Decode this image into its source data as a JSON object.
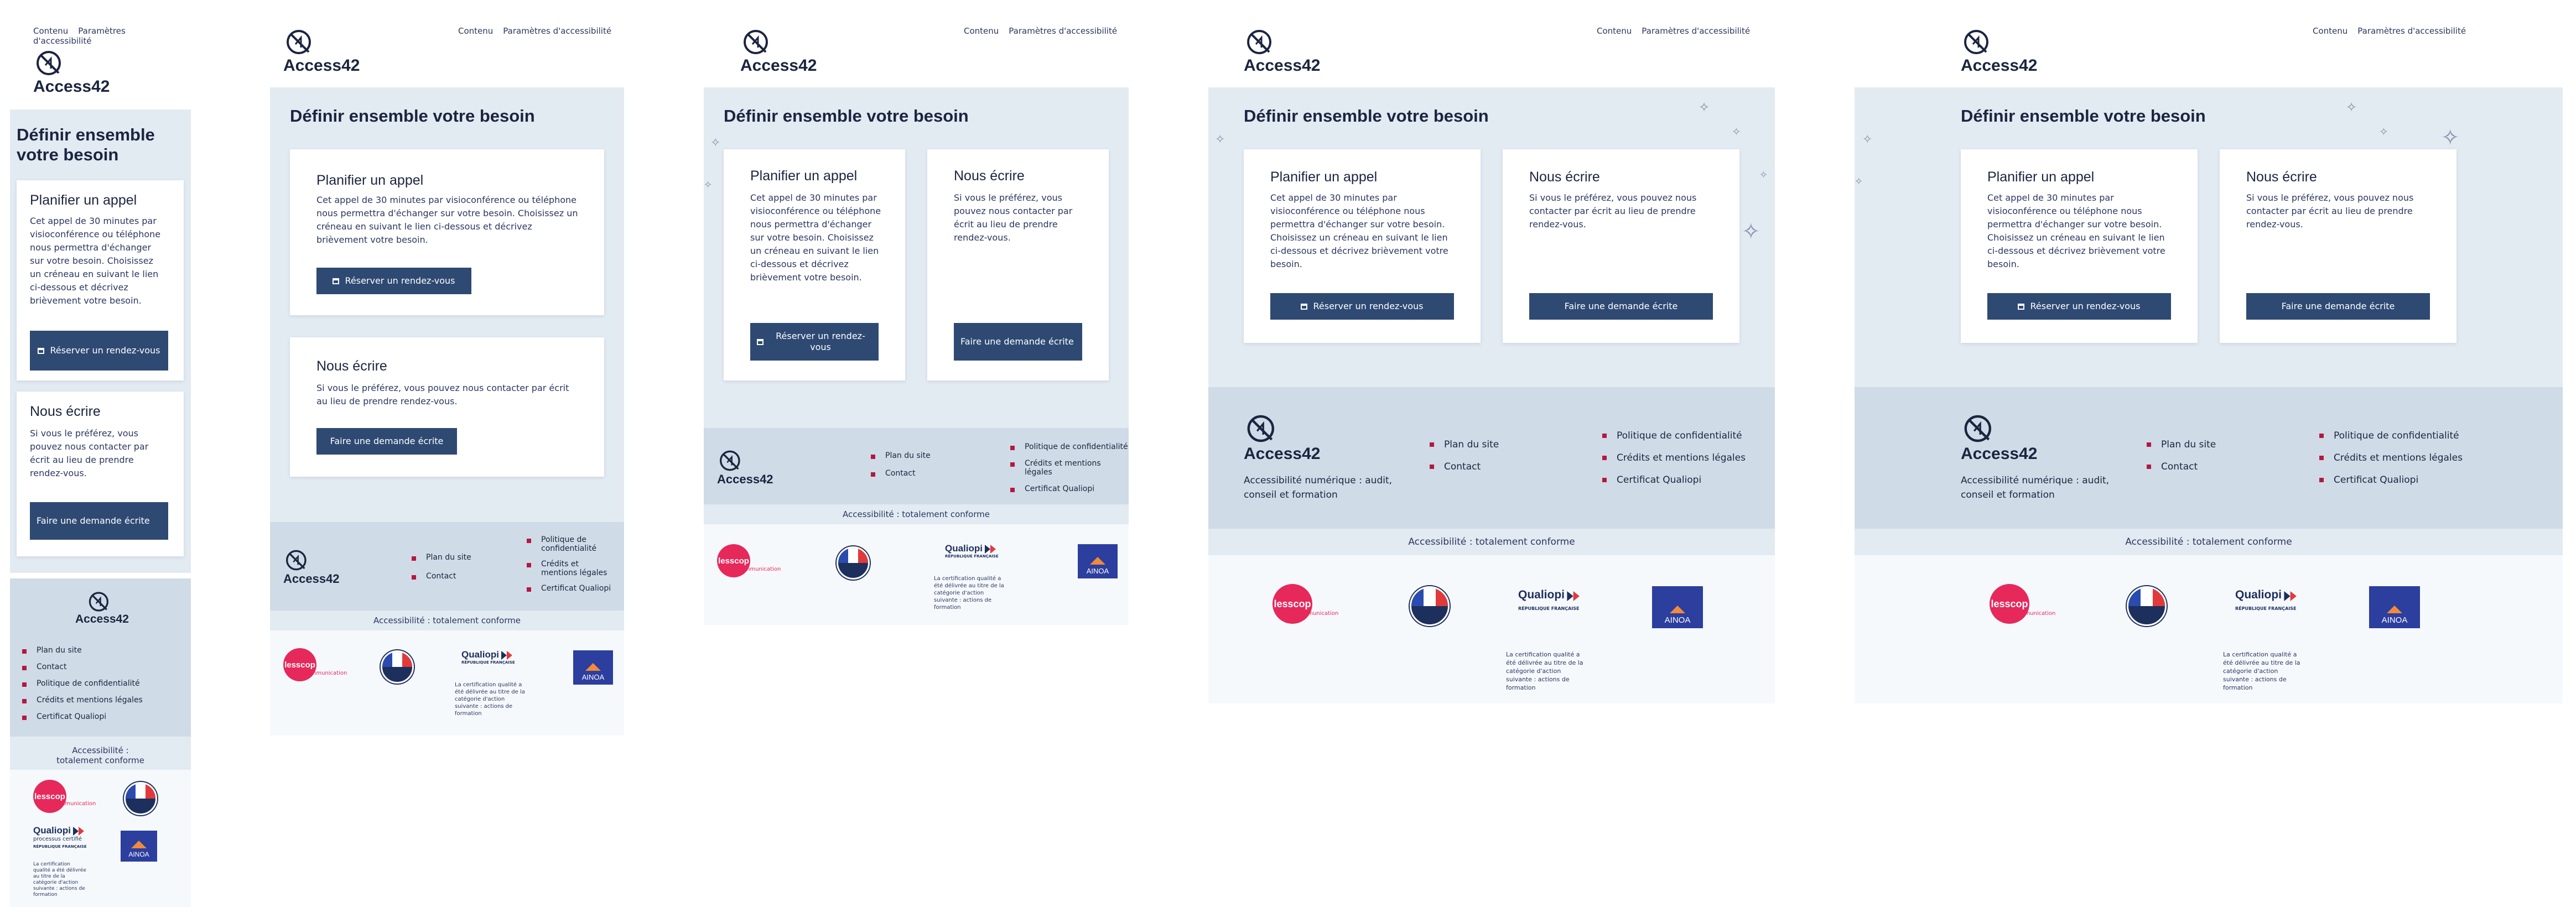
{
  "skip_links": {
    "content": "Contenu",
    "accessibility": "Paramètres d'accessibilité"
  },
  "logo": {
    "name": "Access42"
  },
  "hero": {
    "title": "Définir ensemble votre besoin"
  },
  "call_card": {
    "title": "Planifier un appel",
    "text": "Cet appel de 30 minutes par visioconférence ou téléphone nous permettra d'échanger sur votre besoin. Choisissez un créneau en suivant le lien ci-dessous et décrivez brièvement votre besoin.",
    "button": "Réserver un rendez-vous"
  },
  "write_card": {
    "title": "Nous écrire",
    "text": "Si vous le préférez, vous pouvez nous contacter par écrit au lieu de prendre rendez-vous.",
    "button": "Faire une demande écrite"
  },
  "footer": {
    "tagline": "Accessibilité numérique : audit, conseil et formation",
    "links_col1": [
      "Plan du site",
      "Contact"
    ],
    "links_col2": [
      "Politique de confidentialité",
      "Crédits et mentions légales",
      "Certificat Qualiopi"
    ],
    "conformity": "Accessibilité : totalement conforme"
  },
  "partners": {
    "scop_brand": "lesscop",
    "scop_sub": "communication",
    "qualiopi_brand": "Qualiopi",
    "qualiopi_sub": "processus certifié",
    "qualiopi_rf": "RÉPUBLIQUE FRANÇAISE",
    "qualiopi_note": "La certification qualité a été délivrée au titre de la catégorie d'action suivante : actions de formation",
    "ainoa_brand": "AINOA"
  },
  "colors": {
    "accent": "#2e4a73",
    "hero_bg": "#e2eaf2",
    "footer_bg": "#cfdbe6",
    "bullet": "#b5173f"
  },
  "icons": [
    "access42-logo-icon",
    "calendar-icon",
    "sparkle-icon",
    "bullet-square-icon"
  ]
}
